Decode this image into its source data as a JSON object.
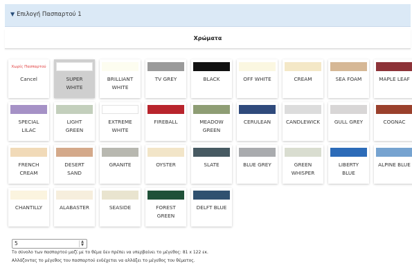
{
  "accordion": {
    "title": "Επιλογή Πασπαρτού 1"
  },
  "section": {
    "title": "Χρώματα"
  },
  "colors": [
    {
      "line1": "Cancel",
      "line2": "",
      "swatch": "",
      "cancel": true,
      "top": "Χωρίς Πασπαρτού"
    },
    {
      "line1": "SUPER",
      "line2": "WHITE",
      "swatch": "#ffffff",
      "selected": true
    },
    {
      "line1": "BRILLIANT",
      "line2": "WHITE",
      "swatch": "#fdfdf0"
    },
    {
      "line1": "TV GREY",
      "line2": "",
      "swatch": "#9a9a9a"
    },
    {
      "line1": "BLACK",
      "line2": "",
      "swatch": "#121212"
    },
    {
      "line1": "OFF WHITE",
      "line2": "",
      "swatch": "#fbf7e1"
    },
    {
      "line1": "CREAM",
      "line2": "",
      "swatch": "#f4e8c7"
    },
    {
      "line1": "SEA FOAM",
      "line2": "",
      "swatch": "#d6b896"
    },
    {
      "line1": "MAPLE LEAF",
      "line2": "",
      "swatch": "#8d3338"
    },
    {
      "line1": "SPECIAL",
      "line2": "LILAC",
      "swatch": "#a591c6"
    },
    {
      "line1": "LIGHT",
      "line2": "GREEN",
      "swatch": "#c3cfbc"
    },
    {
      "line1": "EXTREME",
      "line2": "WHITE",
      "swatch": "#ffffff"
    },
    {
      "line1": "FIREBALL",
      "line2": "",
      "swatch": "#b8242c"
    },
    {
      "line1": "MEADOW",
      "line2": "GREEN",
      "swatch": "#8e9d74"
    },
    {
      "line1": "CERULEAN",
      "line2": "",
      "swatch": "#2f4a7c"
    },
    {
      "line1": "CANDLEWICK",
      "line2": "",
      "swatch": "#dcdcdc"
    },
    {
      "line1": "GULL GREY",
      "line2": "",
      "swatch": "#d8d6d6"
    },
    {
      "line1": "COGNAC",
      "line2": "",
      "swatch": "#9a402c"
    },
    {
      "line1": "FRENCH",
      "line2": "CREAM",
      "swatch": "#f1dab8"
    },
    {
      "line1": "DESERT",
      "line2": "SAND",
      "swatch": "#d4a98a"
    },
    {
      "line1": "GRANITE",
      "line2": "",
      "swatch": "#b8b8b0"
    },
    {
      "line1": "OYSTER",
      "line2": "",
      "swatch": "#f2e5c8"
    },
    {
      "line1": "SLATE",
      "line2": "",
      "swatch": "#475a62"
    },
    {
      "line1": "BLUE GREY",
      "line2": "",
      "swatch": "#a9abae"
    },
    {
      "line1": "GREEN",
      "line2": "WHISPER",
      "swatch": "#d9ddd0"
    },
    {
      "line1": "LIBERTY",
      "line2": "BLUE",
      "swatch": "#2c6bb8"
    },
    {
      "line1": "ALPINE BLUE",
      "line2": "",
      "swatch": "#76a3d0"
    },
    {
      "line1": "CHANTILLY",
      "line2": "",
      "swatch": "#fbf4df"
    },
    {
      "line1": "ALABASTER",
      "line2": "",
      "swatch": "#f6eedd"
    },
    {
      "line1": "SEASIDE",
      "line2": "",
      "swatch": "#e9e4cf"
    },
    {
      "line1": "FOREST",
      "line2": "GREEN",
      "swatch": "#1f5138"
    },
    {
      "line1": "DELFT BLUE",
      "line2": "",
      "swatch": "#2f5170"
    }
  ],
  "quantity": {
    "value": "5"
  },
  "notes": {
    "line1": "Το σύνολο των πασπαρτού μαζί με το θέμα δεν πρέπει να υπερβαίνει το μέγεθος: 81 x 122 εκ.",
    "line2": "Αλλάζοντας το μέγεθος του πασπαρτού ενδέχεται να αλλάξει το μέγεθος του θέματος."
  }
}
